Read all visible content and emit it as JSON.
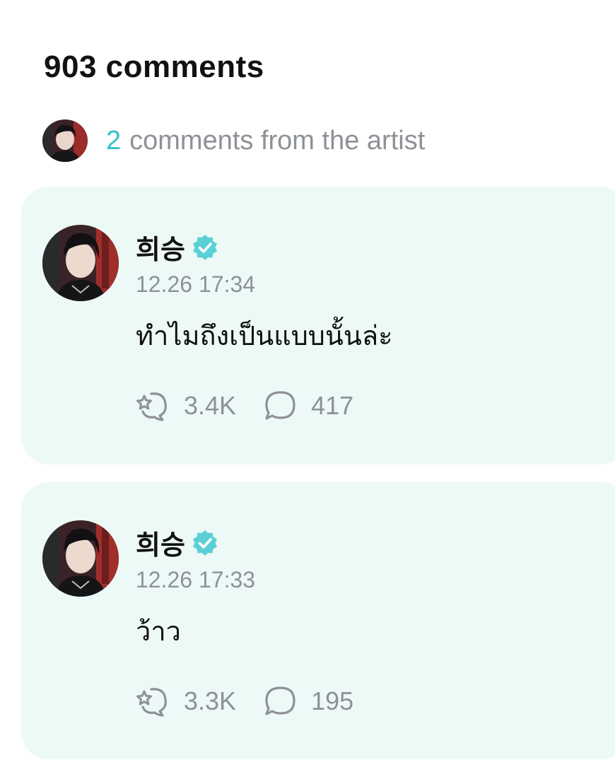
{
  "header": {
    "title": "903 comments"
  },
  "artist_summary": {
    "count": "2",
    "label": "comments from the artist"
  },
  "comments": [
    {
      "author": "희승",
      "timestamp": "12.26 17:34",
      "text": "ทำไมถึงเป็นแบบนั้นล่ะ",
      "likes": "3.4K",
      "replies": "417"
    },
    {
      "author": "희승",
      "timestamp": "12.26 17:33",
      "text": "ว้าว",
      "likes": "3.3K",
      "replies": "195"
    }
  ],
  "colors": {
    "accent": "#33c2c9",
    "card_bg": "#ecf9f7",
    "muted": "#8e9196"
  },
  "icons": {
    "verified": "verified-badge-icon",
    "like": "cheer-icon",
    "reply": "speech-bubble-icon"
  }
}
